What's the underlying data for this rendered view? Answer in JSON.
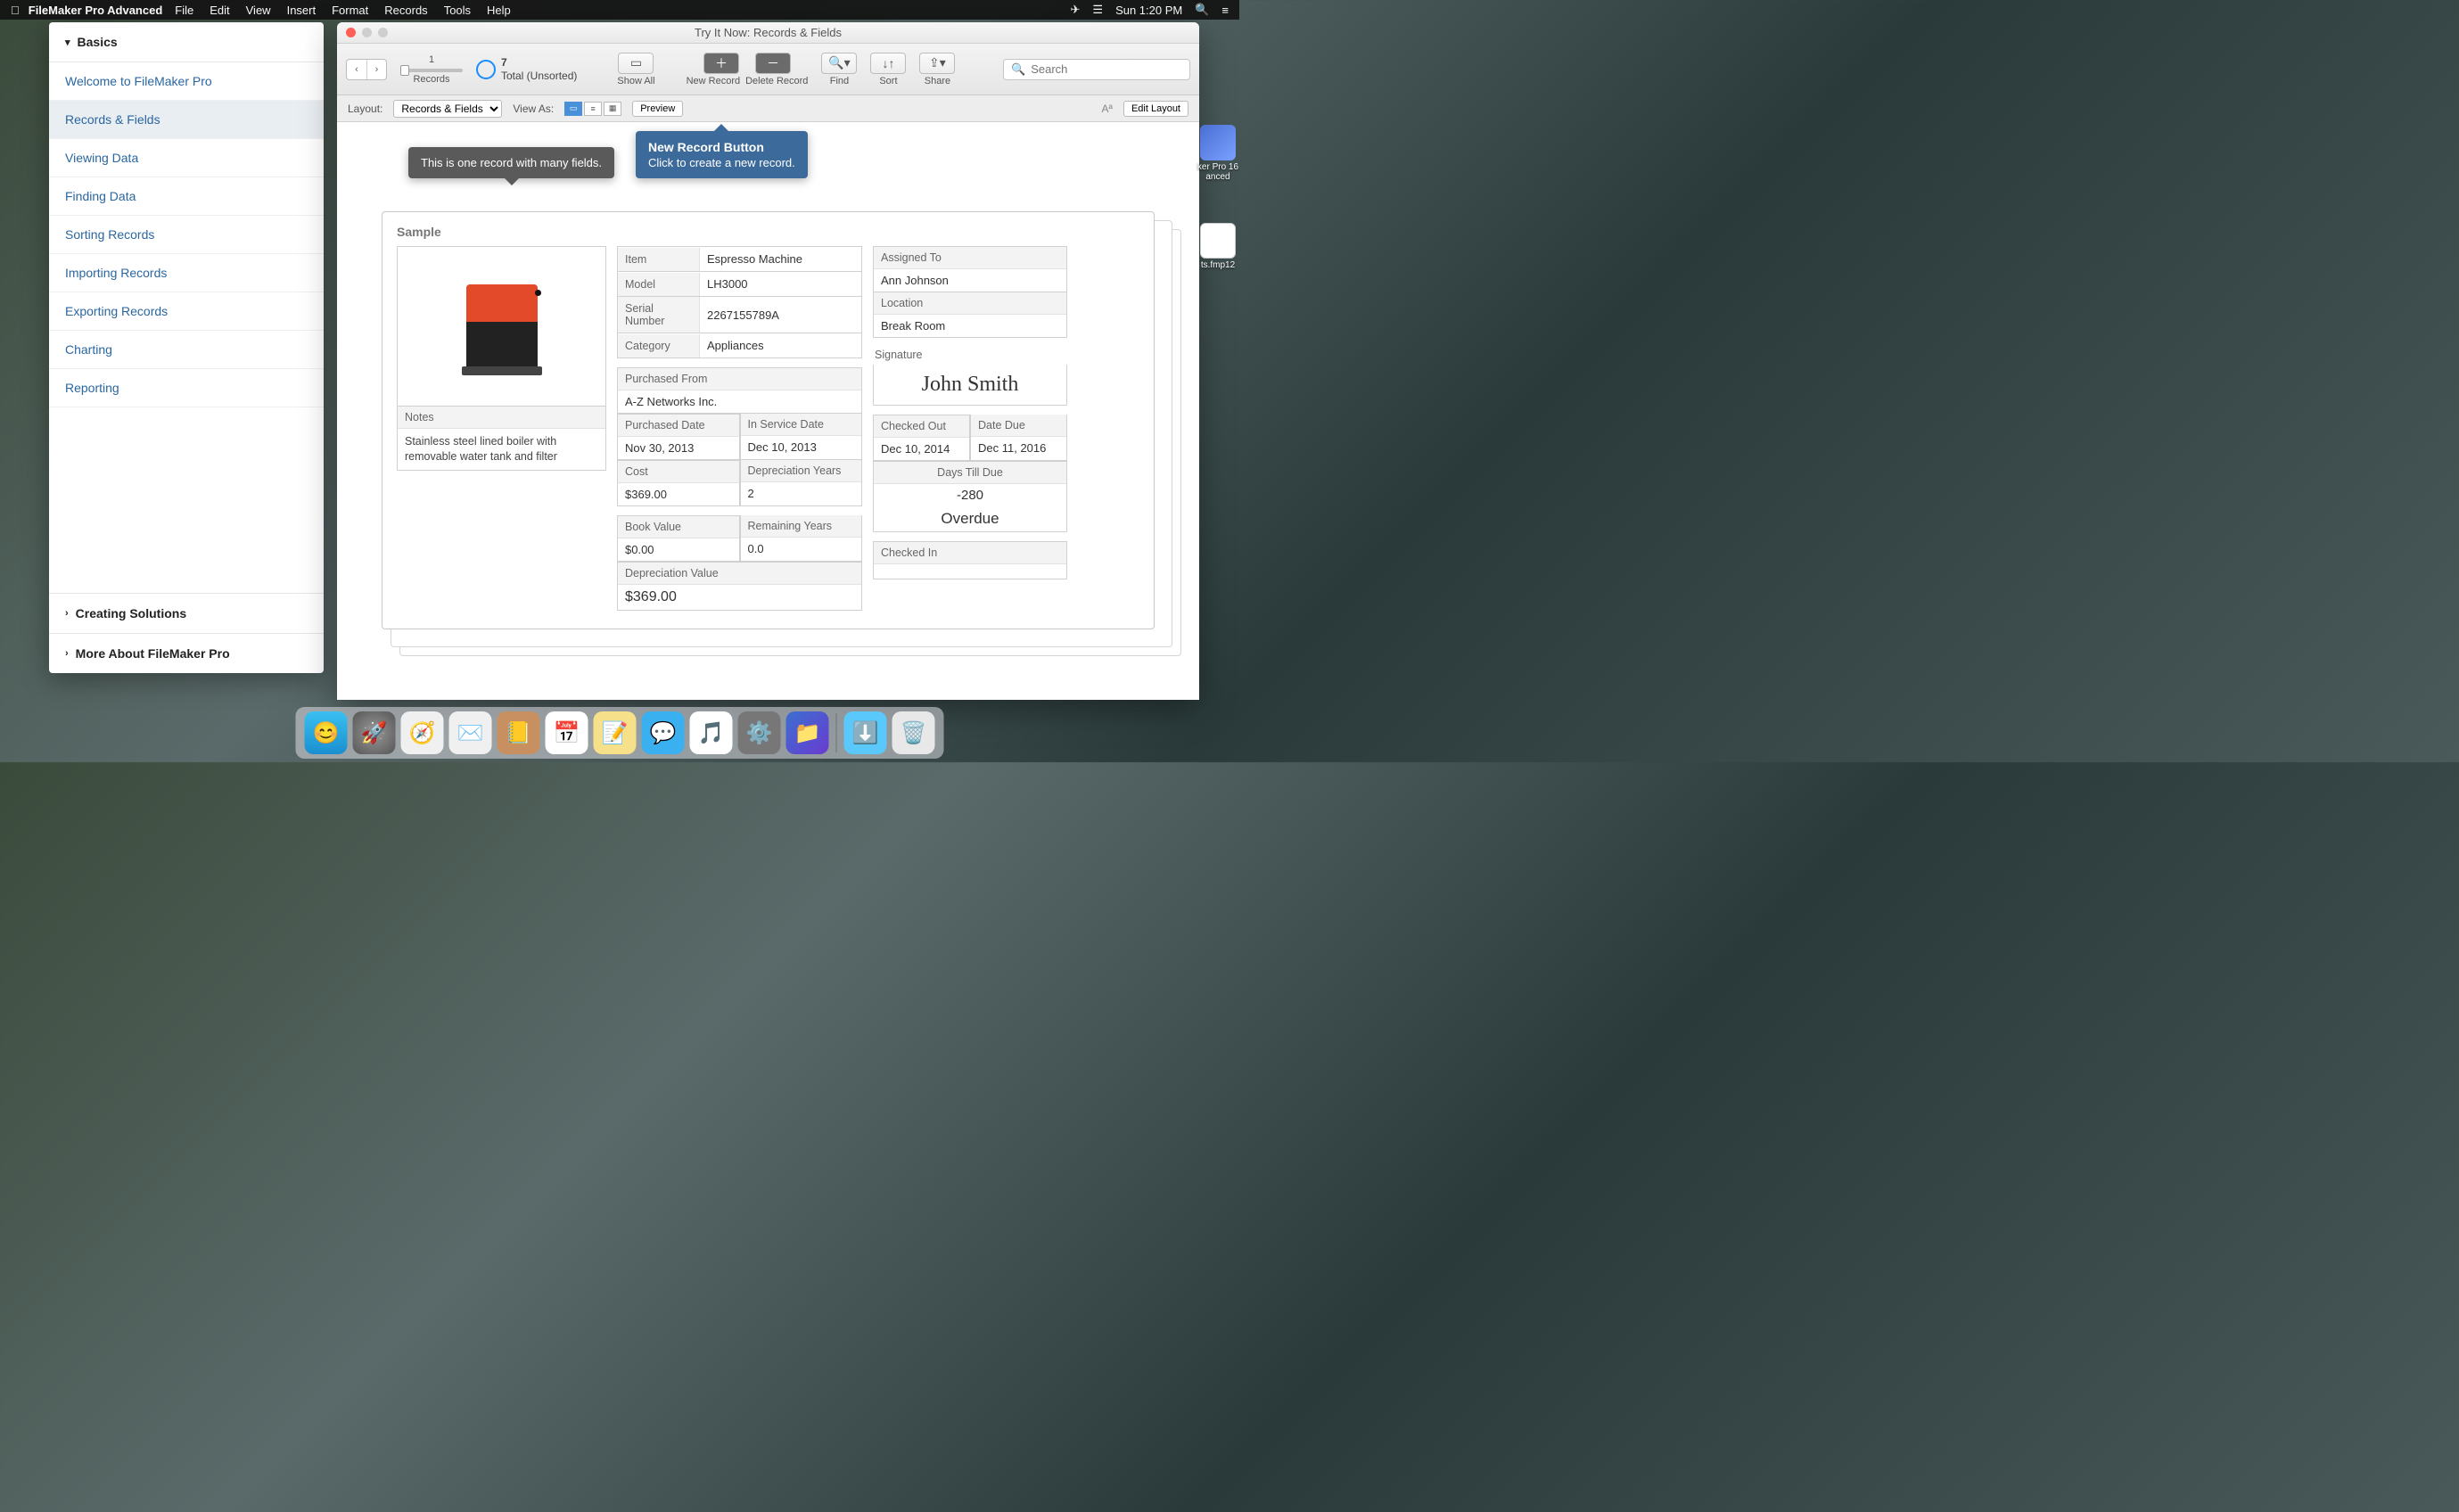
{
  "menubar": {
    "app": "FileMaker Pro Advanced",
    "items": [
      "File",
      "Edit",
      "View",
      "Insert",
      "Format",
      "Records",
      "Tools",
      "Help"
    ],
    "clock": "Sun 1:20 PM"
  },
  "sidebar": {
    "sections": {
      "basics": "Basics",
      "creating": "Creating Solutions",
      "more": "More About FileMaker Pro"
    },
    "items": [
      "Welcome to FileMaker Pro",
      "Records & Fields",
      "Viewing Data",
      "Finding Data",
      "Sorting Records",
      "Importing Records",
      "Exporting Records",
      "Charting",
      "Reporting"
    ]
  },
  "window": {
    "title": "Try It Now: Records & Fields",
    "record_current": "1",
    "record_total": "7",
    "sort_state": "Total (Unsorted)",
    "toolbar": {
      "records": "Records",
      "show_all": "Show All",
      "new_record": "New Record",
      "delete_record": "Delete Record",
      "find": "Find",
      "sort": "Sort",
      "share": "Share",
      "search_placeholder": "Search"
    },
    "subtoolbar": {
      "layout_label": "Layout:",
      "layout_value": "Records & Fields",
      "view_as": "View As:",
      "preview": "Preview",
      "edit_layout": "Edit Layout"
    }
  },
  "callouts": {
    "gray": "This is one record with many fields.",
    "blue_title": "New Record Button",
    "blue_body": "Click to create a new record."
  },
  "record": {
    "sample_label": "Sample",
    "item_l": "Item",
    "item": "Espresso Machine",
    "model_l": "Model",
    "model": "LH3000",
    "serial_l": "Serial Number",
    "serial": "2267155789A",
    "category_l": "Category",
    "category": "Appliances",
    "notes_l": "Notes",
    "notes": "Stainless steel lined boiler with removable water tank and filter",
    "purchased_from_l": "Purchased From",
    "purchased_from": "A-Z Networks Inc.",
    "purchased_date_l": "Purchased Date",
    "purchased_date": "Nov 30, 2013",
    "in_service_l": "In Service Date",
    "in_service": "Dec 10, 2013",
    "cost_l": "Cost",
    "cost": "$369.00",
    "dep_years_l": "Depreciation Years",
    "dep_years": "2",
    "book_value_l": "Book Value",
    "book_value": "$0.00",
    "remaining_l": "Remaining Years",
    "remaining": "0.0",
    "dep_value_l": "Depreciation Value",
    "dep_value": "$369.00",
    "assigned_l": "Assigned To",
    "assigned": "Ann Johnson",
    "location_l": "Location",
    "location": "Break Room",
    "signature_l": "Signature",
    "signature": "John Smith",
    "checked_out_l": "Checked Out",
    "checked_out": "Dec 10, 2014",
    "date_due_l": "Date Due",
    "date_due": "Dec 11, 2016",
    "days_till_l": "Days Till Due",
    "days_till": "-280",
    "overdue": "Overdue",
    "checked_in_l": "Checked In",
    "checked_in": ""
  },
  "desktop": {
    "icon1": "ker Pro 16\nanced",
    "icon2": "ts.fmp12"
  }
}
